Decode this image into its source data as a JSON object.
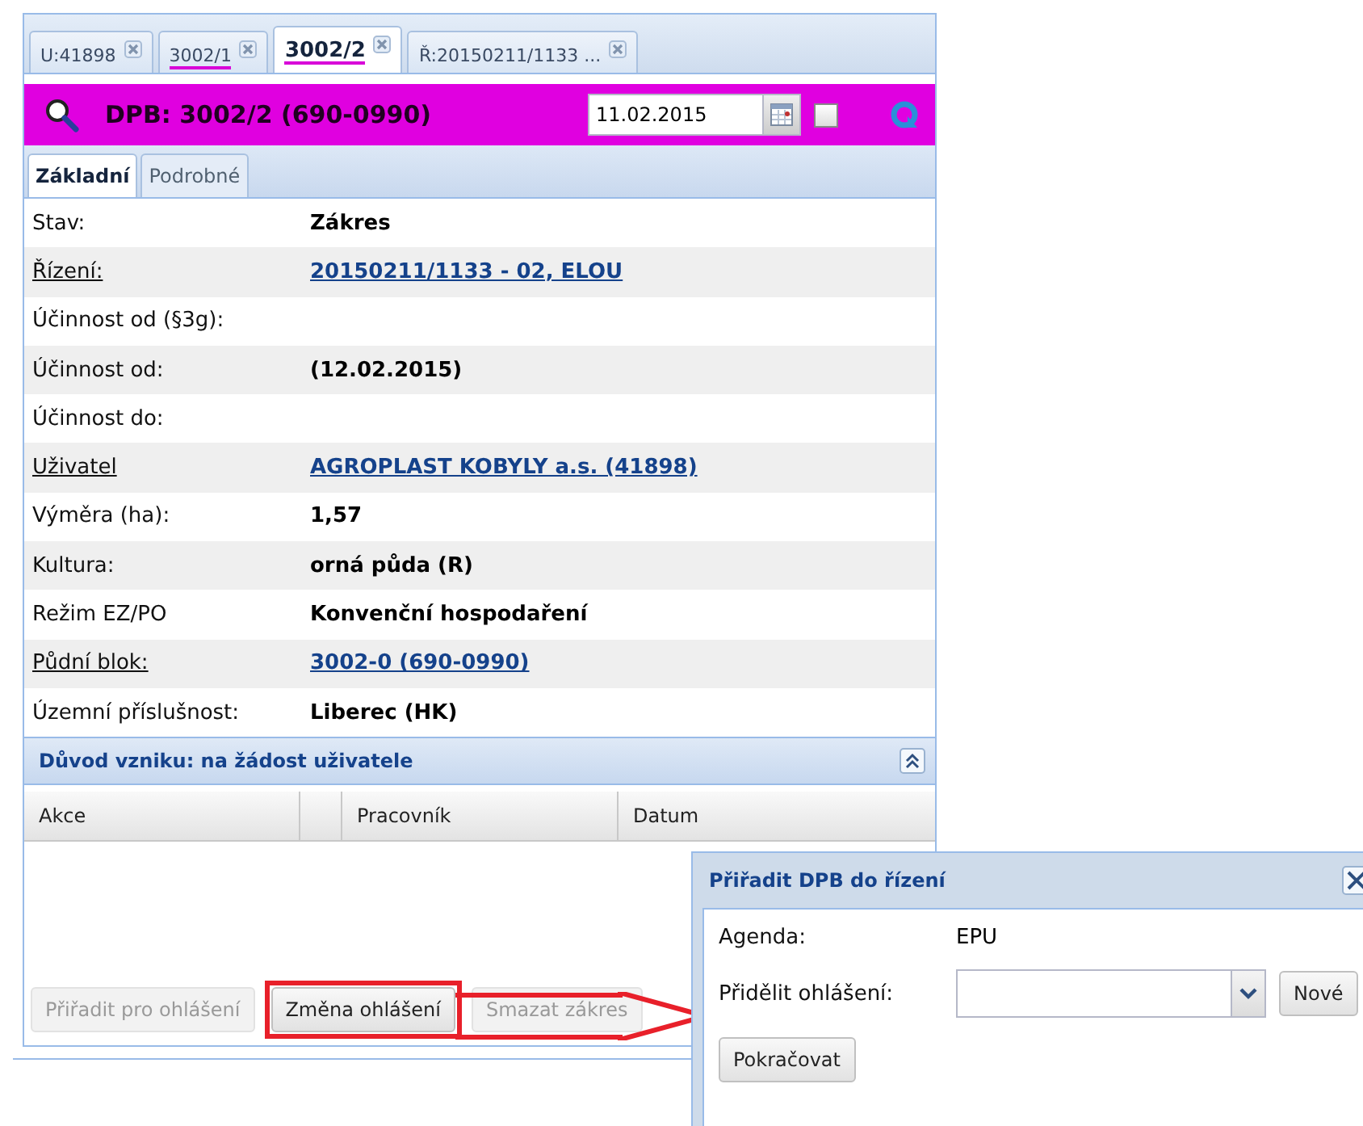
{
  "tabs": [
    {
      "label": "U:41898",
      "selected": false,
      "marked": false
    },
    {
      "label": "3002/1",
      "selected": false,
      "marked": true
    },
    {
      "label": "3002/2",
      "selected": true,
      "marked": true
    },
    {
      "label": "Ř:20150211/1133 ...",
      "selected": false,
      "marked": false
    }
  ],
  "header": {
    "title": "DPB: 3002/2 (690-0990)",
    "date": "11.02.2015",
    "checked": false
  },
  "subtabs": [
    {
      "label": "Základní",
      "selected": true
    },
    {
      "label": "Podrobné",
      "selected": false
    }
  ],
  "fields": [
    {
      "label": {
        "text": "Stav:",
        "kind": "plain"
      },
      "value": {
        "text": "Zákres",
        "kind": "bold"
      }
    },
    {
      "label": {
        "text": "Řízení:",
        "kind": "link"
      },
      "value": {
        "text": "20150211/1133 - 02, ELOU",
        "kind": "link"
      }
    },
    {
      "label": {
        "text": "Účinnost od (§3g):",
        "kind": "plain"
      }
    },
    {
      "label": {
        "text": "Účinnost od:",
        "kind": "plain"
      },
      "value": {
        "text": "(12.02.2015)",
        "kind": "bold"
      }
    },
    {
      "label": {
        "text": "Účinnost do:",
        "kind": "plain"
      }
    },
    {
      "label": {
        "text": "Uživatel",
        "kind": "link"
      },
      "value": {
        "text": "AGROPLAST KOBYLY a.s. (41898)",
        "kind": "link"
      }
    },
    {
      "label": {
        "text": "Výměra (ha):",
        "kind": "plain"
      },
      "value": {
        "text": "1,57",
        "kind": "bold"
      }
    },
    {
      "label": {
        "text": "Kultura:",
        "kind": "plain"
      },
      "value": {
        "text": "orná půda (R)",
        "kind": "bold"
      }
    },
    {
      "label": {
        "text": "Režim EZ/PO",
        "kind": "plain"
      },
      "value": {
        "text": "Konvenční hospodaření",
        "kind": "bold"
      }
    },
    {
      "label": {
        "text": "Půdní blok:",
        "kind": "link"
      },
      "value": {
        "text": "3002-0 (690-0990)",
        "kind": "link"
      }
    },
    {
      "label": {
        "text": "Územní příslušnost:",
        "kind": "plain"
      },
      "value": {
        "text": "Liberec (HK)",
        "kind": "bold"
      }
    }
  ],
  "section": {
    "title": "Důvod vzniku: na žádost uživatele",
    "expanded": true
  },
  "table": {
    "columns": [
      {
        "kind": "text",
        "label": "Akce"
      },
      {
        "kind": "blank"
      },
      {
        "kind": "text",
        "label": "Pracovník"
      },
      {
        "kind": "text",
        "label": "Datum"
      }
    ]
  },
  "buttons": [
    {
      "label": "Přiřadit pro ohlášení",
      "disabled": true,
      "highlighted": false
    },
    {
      "label": "Změna ohlášení",
      "disabled": false,
      "highlighted": true
    },
    {
      "label": "Smazat zákres",
      "disabled": true,
      "highlighted": false
    }
  ],
  "dialog": {
    "title": "Přiřadit DPB do řízení",
    "agenda_label": "Agenda:",
    "agenda_value": "EPU",
    "assign_label": "Přidělit ohlášení:",
    "new_button": "Nové",
    "continue_button": "Pokračovat"
  }
}
